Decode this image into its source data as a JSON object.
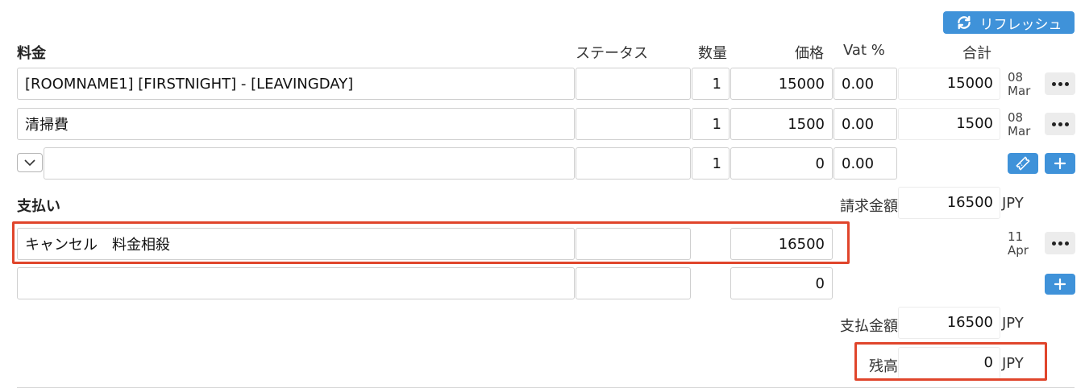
{
  "toolbar": {
    "refresh_label": "リフレッシュ",
    "refresh_icon": "refresh-icon"
  },
  "charges": {
    "title": "料金",
    "headers": {
      "status": "ステータス",
      "qty": "数量",
      "price": "価格",
      "vat": "Vat %",
      "total": "合計"
    },
    "rows": [
      {
        "description": "[ROOMNAME1] [FIRSTNIGHT] - [LEAVINGDAY]",
        "status": "",
        "qty": "1",
        "price": "15000",
        "vat": "0.00",
        "total": "15000",
        "date_day": "08",
        "date_month": "Mar"
      },
      {
        "description": "清掃費",
        "status": "",
        "qty": "1",
        "price": "1500",
        "vat": "0.00",
        "total": "1500",
        "date_day": "08",
        "date_month": "Mar"
      }
    ],
    "new_row": {
      "description": "",
      "status": "",
      "qty": "1",
      "price": "0",
      "vat": "0.00"
    },
    "invoice_label": "請求金額",
    "invoice_amount": "16500",
    "currency": "JPY"
  },
  "payments": {
    "title": "支払い",
    "rows": [
      {
        "description": "キャンセル　料金相殺",
        "status": "",
        "amount": "16500",
        "date_day": "11",
        "date_month": "Apr"
      }
    ],
    "new_row": {
      "description": "",
      "status": "",
      "amount": "0"
    },
    "paid_label": "支払金額",
    "paid_amount": "16500",
    "balance_label": "残高",
    "balance_amount": "0",
    "currency": "JPY"
  },
  "colors": {
    "accent": "#3f92d9",
    "highlight": "#e0452b",
    "more_button_bg": "#ececec"
  }
}
